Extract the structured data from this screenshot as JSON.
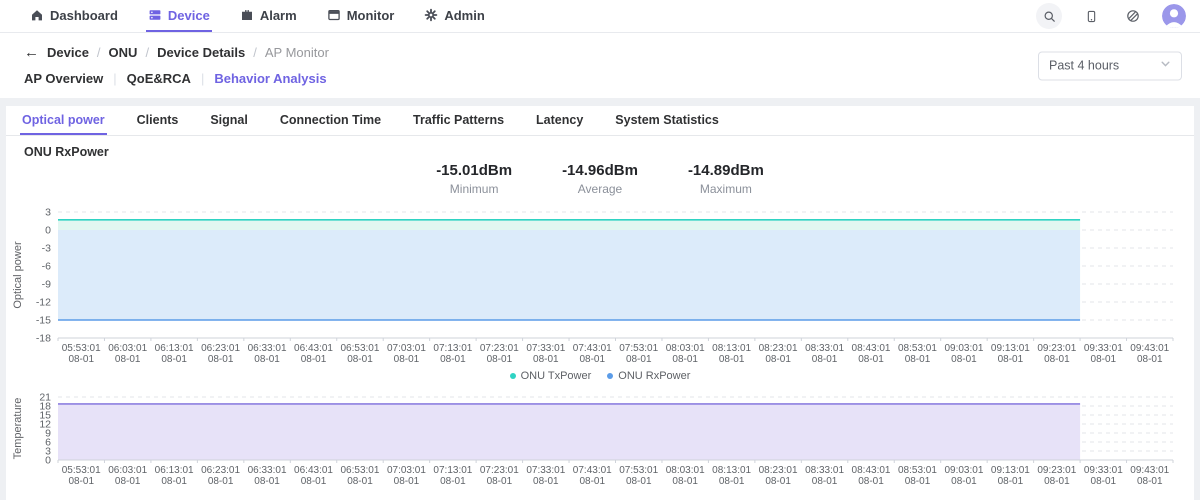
{
  "navbar": {
    "items": [
      {
        "label": "Dashboard",
        "icon": "home-icon",
        "active": false
      },
      {
        "label": "Device",
        "icon": "device-icon",
        "active": true
      },
      {
        "label": "Alarm",
        "icon": "alarm-icon",
        "active": false
      },
      {
        "label": "Monitor",
        "icon": "monitor-icon",
        "active": false
      },
      {
        "label": "Admin",
        "icon": "gear-icon",
        "active": false
      }
    ],
    "right_icons": [
      {
        "name": "search-icon",
        "circled": true
      },
      {
        "name": "mobile-icon",
        "circled": false
      },
      {
        "name": "globe-icon",
        "circled": false
      }
    ]
  },
  "breadcrumb": {
    "back_icon": "arrow-left-icon",
    "separator": "/",
    "items": [
      {
        "label": "Device",
        "current": false
      },
      {
        "label": "ONU",
        "current": false
      },
      {
        "label": "Device Details",
        "current": false
      },
      {
        "label": "AP Monitor",
        "current": true
      }
    ]
  },
  "subnav": {
    "separator": "|",
    "items": [
      {
        "label": "AP Overview",
        "active": false
      },
      {
        "label": "QoE&RCA",
        "active": false
      },
      {
        "label": "Behavior Analysis",
        "active": true
      }
    ]
  },
  "time_range": {
    "value": "Past 4 hours"
  },
  "tabs": [
    {
      "label": "Optical power",
      "active": true
    },
    {
      "label": "Clients",
      "active": false
    },
    {
      "label": "Signal",
      "active": false
    },
    {
      "label": "Connection Time",
      "active": false
    },
    {
      "label": "Traffic Patterns",
      "active": false
    },
    {
      "label": "Latency",
      "active": false
    },
    {
      "label": "System Statistics",
      "active": false
    }
  ],
  "section_title": "ONU RxPower",
  "stats": [
    {
      "value": "-15.01dBm",
      "label": "Minimum"
    },
    {
      "value": "-14.96dBm",
      "label": "Average"
    },
    {
      "value": "-14.89dBm",
      "label": "Maximum"
    }
  ],
  "colors": {
    "accent": "#6f63e2",
    "tx_line": "#2fd3c3",
    "tx_fill": "#e2f7f1",
    "rx_line": "#5b9ce8",
    "rx_fill": "#dcebfa",
    "temp_line": "#8d7fe0",
    "temp_fill": "#e7e2f8",
    "grid": "#e3e5e9",
    "axis": "#cfd3da",
    "tick_text": "#5f6368"
  },
  "chart_data": [
    {
      "type": "area",
      "title": "ONU optical power",
      "ylabel": "Optical power",
      "ylim": [
        -18,
        3
      ],
      "yticks": [
        3,
        0,
        -3,
        -6,
        -9,
        -12,
        -15,
        -18
      ],
      "x": [
        "05:53:01",
        "06:03:01",
        "06:13:01",
        "06:23:01",
        "06:33:01",
        "06:43:01",
        "06:53:01",
        "07:03:01",
        "07:13:01",
        "07:23:01",
        "07:33:01",
        "07:43:01",
        "07:53:01",
        "08:03:01",
        "08:13:01",
        "08:23:01",
        "08:33:01",
        "08:43:01",
        "08:53:01",
        "09:03:01",
        "09:13:01",
        "09:23:01",
        "09:33:01",
        "09:43:01"
      ],
      "x_date": "08-01",
      "data_end_index": 21,
      "series": [
        {
          "name": "ONU TxPower",
          "value": 1.7,
          "color": "#2fd3c3",
          "fill": "#e2f7f1"
        },
        {
          "name": "ONU RxPower",
          "value": -15.0,
          "color": "#5b9ce8",
          "fill": "#dcebfa"
        }
      ],
      "legend": {
        "show": true,
        "position": "bottom",
        "items": [
          "ONU TxPower",
          "ONU RxPower"
        ]
      },
      "grid": "dashed-horizontal"
    },
    {
      "type": "area",
      "title": "ONU temperature",
      "ylabel": "Temperature",
      "ylim": [
        0,
        21
      ],
      "yticks": [
        21,
        18,
        15,
        12,
        9,
        6,
        3,
        0
      ],
      "x": [
        "05:53:01",
        "06:03:01",
        "06:13:01",
        "06:23:01",
        "06:33:01",
        "06:43:01",
        "06:53:01",
        "07:03:01",
        "07:13:01",
        "07:23:01",
        "07:33:01",
        "07:43:01",
        "07:53:01",
        "08:03:01",
        "08:13:01",
        "08:23:01",
        "08:33:01",
        "08:43:01",
        "08:53:01",
        "09:03:01",
        "09:13:01",
        "09:23:01",
        "09:33:01",
        "09:43:01"
      ],
      "x_date": "08-01",
      "data_end_index": 21,
      "series": [
        {
          "name": "Temperature",
          "value": 18.7,
          "color": "#8d7fe0",
          "fill": "#e7e2f8"
        }
      ],
      "legend": {
        "show": false
      },
      "grid": "dashed-horizontal"
    }
  ]
}
